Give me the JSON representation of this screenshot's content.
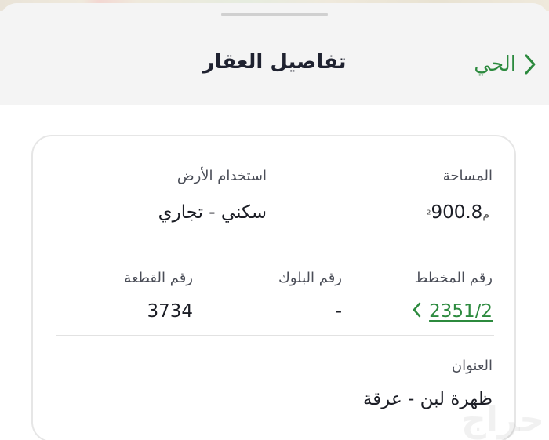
{
  "header": {
    "title": "تفاصيل العقار",
    "back_label": "الحي",
    "accent_color": "#2c8a3e"
  },
  "details": {
    "area": {
      "label": "المساحة",
      "value": "900.8",
      "unit": "م²"
    },
    "land_use": {
      "label": "استخدام الأرض",
      "value": "سكني - تجاري"
    },
    "plan_number": {
      "label": "رقم المخطط",
      "value": "2351/2"
    },
    "block_number": {
      "label": "رقم البلوك",
      "value": "-"
    },
    "parcel_number": {
      "label": "رقم القطعة",
      "value": "3734"
    },
    "address": {
      "label": "العنوان",
      "value": "ظهرة لبن - عرقة"
    }
  },
  "watermark": "حراج",
  "icons": {
    "back": "chevron-right-icon",
    "plan_link": "chevron-left-icon"
  }
}
